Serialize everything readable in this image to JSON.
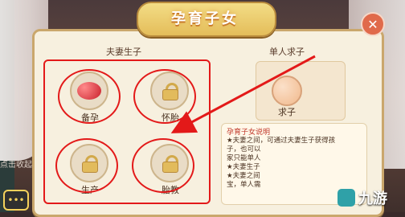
{
  "game": {
    "panel_title": "孕育子女",
    "close_symbol": "✕",
    "left_hint": "点击收起",
    "sections": {
      "left_title": "夫妻生子",
      "right_title": "单人求子"
    },
    "skills": [
      {
        "label": "备孕",
        "icon": "baby-red-icon",
        "locked": false
      },
      {
        "label": "怀胎",
        "icon": "lock-icon",
        "locked": true
      },
      {
        "label": "生产",
        "icon": "lock-icon",
        "locked": true
      },
      {
        "label": "胎教",
        "icon": "lock-icon",
        "locked": true
      }
    ],
    "single": {
      "label": "求子",
      "icon": "baby-face-icon"
    },
    "description": {
      "title": "孕育子女说明",
      "lines": [
        "★夫妻之间，可通过夫妻生子获得孩",
        "子，也可以",
        "家只能单人",
        "★夫妻生子",
        "★夫妻之间",
        "宝，单人需"
      ]
    }
  },
  "watermark": {
    "text": "九游"
  },
  "colors": {
    "annotation_red": "#e31919",
    "panel_bg": "#f7f0df",
    "title_glow": "#e0a14a"
  }
}
